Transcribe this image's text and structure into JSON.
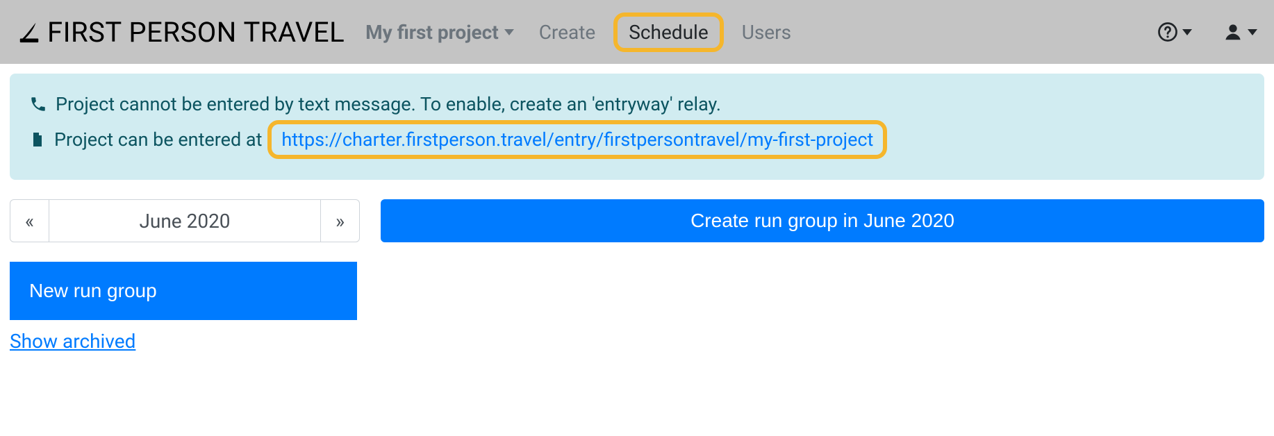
{
  "brand": {
    "name": "FIRST PERSON TRAVEL"
  },
  "nav": {
    "project_label": "My first project",
    "create": "Create",
    "schedule": "Schedule",
    "users": "Users"
  },
  "alert": {
    "line1": "Project cannot be entered by text message. To enable, create an 'entryway' relay.",
    "line2_prefix": "Project can be entered at",
    "entry_url": "https://charter.firstperson.travel/entry/firstpersontravel/my-first-project"
  },
  "month": {
    "prev": "«",
    "label": "June 2020",
    "next": "»"
  },
  "buttons": {
    "create_run_group_month": "Create run group in June 2020",
    "new_run_group": "New run group",
    "show_archived": "Show archived"
  }
}
